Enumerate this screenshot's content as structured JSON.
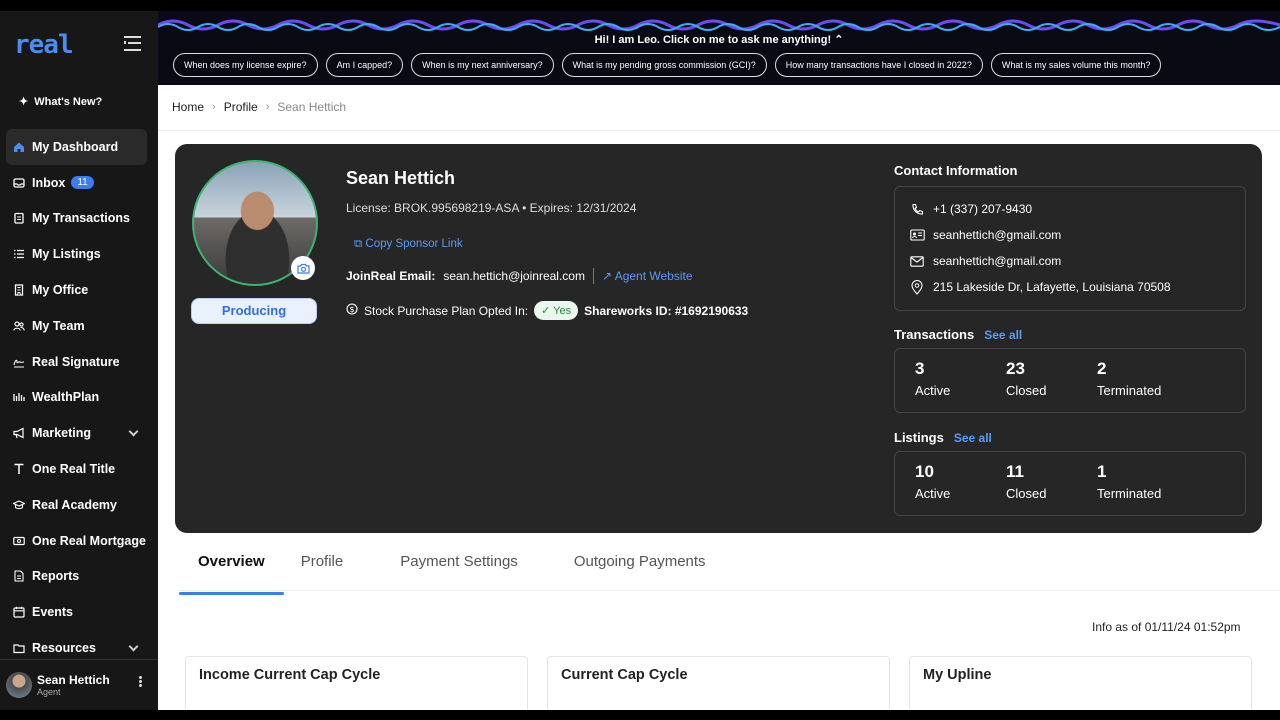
{
  "sidebar": {
    "logo": "real",
    "whats_new": "What's New?",
    "items": [
      {
        "label": "My Dashboard",
        "icon": "home-icon"
      },
      {
        "label": "Inbox",
        "icon": "inbox-icon",
        "badge": "11"
      },
      {
        "label": "My Transactions",
        "icon": "clipboard-icon"
      },
      {
        "label": "My Listings",
        "icon": "list-icon"
      },
      {
        "label": "My Office",
        "icon": "building-icon"
      },
      {
        "label": "My Team",
        "icon": "team-icon"
      },
      {
        "label": "Real Signature",
        "icon": "signature-icon"
      },
      {
        "label": "WealthPlan",
        "icon": "wealth-icon"
      },
      {
        "label": "Marketing",
        "icon": "megaphone-icon"
      },
      {
        "label": "One Real Title",
        "icon": "title-icon"
      },
      {
        "label": "Real Academy",
        "icon": "academy-icon"
      },
      {
        "label": "One Real Mortgage",
        "icon": "mortgage-icon"
      },
      {
        "label": "Reports",
        "icon": "reports-icon"
      },
      {
        "label": "Events",
        "icon": "calendar-icon"
      },
      {
        "label": "Resources",
        "icon": "resources-icon"
      }
    ],
    "user": {
      "name": "Sean Hettich",
      "role": "Agent"
    }
  },
  "topbar": {
    "leo_text": "Hi! I am Leo. Click on me to ask me anything!",
    "chips": [
      "When does my license expire?",
      "Am I capped?",
      "When is my next anniversary?",
      "What is my pending gross commission (GCI)?",
      "How many transactions have I closed in 2022?",
      "What is my sales volume this month?"
    ]
  },
  "breadcrumb": [
    "Home",
    "Profile",
    "Sean Hettich"
  ],
  "profile": {
    "name": "Sean Hettich",
    "license": "License: BROK.995698219-ASA  •  Expires: 12/31/2024",
    "status": "Producing",
    "copy_sponsor": "Copy Sponsor Link",
    "joinreal_label": "JoinReal Email:",
    "joinreal_email": "sean.hettich@joinreal.com",
    "agent_website": "Agent Website",
    "stock_label": "Stock Purchase Plan Opted In:",
    "stock_value": "Yes",
    "shareworks": "Shareworks ID:  #1692190633"
  },
  "contact": {
    "title": "Contact Information",
    "phone": "+1 (337) 207-9430",
    "email1": "seanhettich@gmail.com",
    "email2": "seanhettich@gmail.com",
    "address": "215 Lakeside Dr, Lafayette, Louisiana 70508"
  },
  "transactions": {
    "title": "Transactions",
    "see_all": "See all",
    "stats": [
      {
        "n": "3",
        "l": "Active"
      },
      {
        "n": "23",
        "l": "Closed"
      },
      {
        "n": "2",
        "l": "Terminated"
      }
    ]
  },
  "listings": {
    "title": "Listings",
    "see_all": "See all",
    "stats": [
      {
        "n": "10",
        "l": "Active"
      },
      {
        "n": "11",
        "l": "Closed"
      },
      {
        "n": "1",
        "l": "Terminated"
      }
    ]
  },
  "tabs": [
    "Overview",
    "Profile",
    "Payment Settings",
    "Outgoing Payments"
  ],
  "info_as_of": "Info as of 01/11/24 01:52pm",
  "panels": [
    "Income Current Cap Cycle",
    "Current Cap Cycle",
    "My Upline"
  ]
}
